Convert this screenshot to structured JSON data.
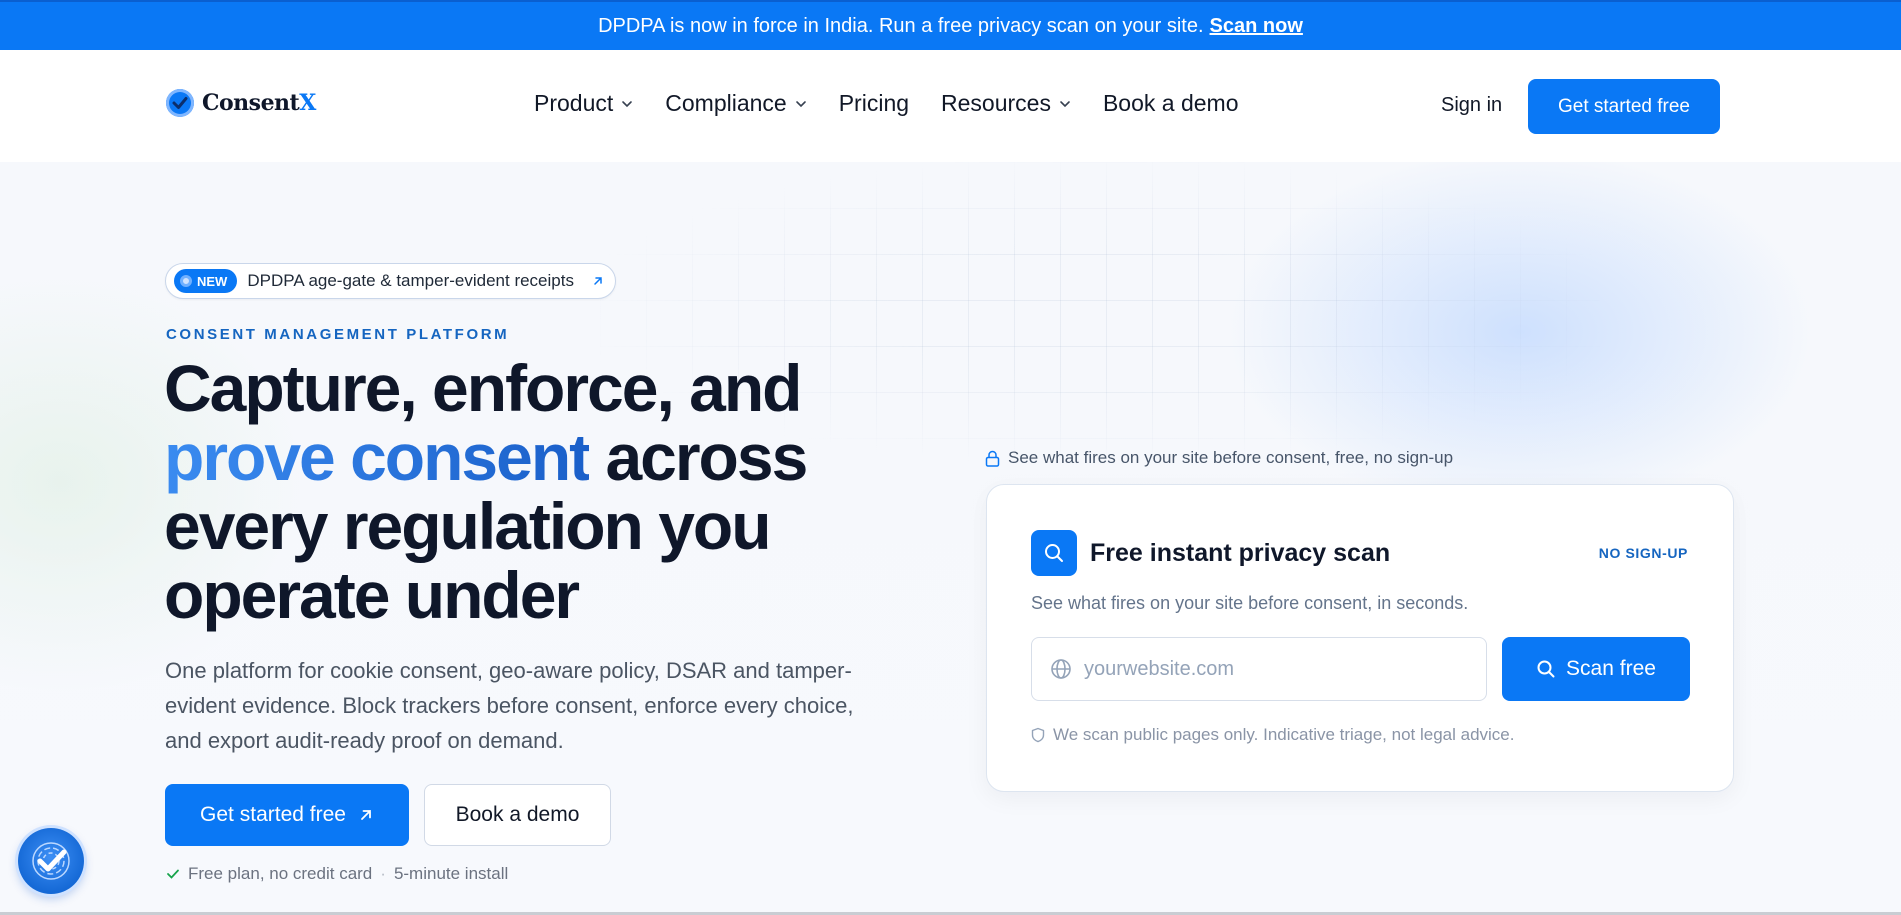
{
  "announcement": {
    "text": "DPDPA is now in force in India. Run a free privacy scan on your site.",
    "link": "Scan now"
  },
  "nav": {
    "logo": {
      "brand_main": "Consent",
      "brand_accent": "X"
    },
    "items": [
      {
        "label": "Product",
        "dropdown": true
      },
      {
        "label": "Compliance",
        "dropdown": true
      },
      {
        "label": "Pricing",
        "dropdown": false
      },
      {
        "label": "Resources",
        "dropdown": true
      },
      {
        "label": "Book a demo",
        "dropdown": false
      }
    ],
    "sign_in": "Sign in",
    "cta": "Get started free"
  },
  "hero": {
    "pill": {
      "badge": "NEW",
      "text": "DPDPA age-gate & tamper-evident receipts"
    },
    "eyebrow": "CONSENT MANAGEMENT PLATFORM",
    "headline": {
      "line1": "Capture, enforce, and",
      "highlight": "prove consent",
      "rest2": " across",
      "line3": "every regulation you",
      "line4": "operate under"
    },
    "subtext": "One platform for cookie consent, geo-aware policy, DSAR and tamper-evident evidence. Block trackers before consent, enforce every choice, and export audit-ready proof on demand.",
    "primary_button": "Get started free",
    "secondary_button": "Book a demo",
    "trust": {
      "item1": "Free plan, no credit card",
      "separator": "·",
      "item2": "5-minute install"
    }
  },
  "scan": {
    "note": "See what fires on your site before consent, free, no sign-up",
    "title": "Free instant privacy scan",
    "tag": "NO SIGN-UP",
    "description": "See what fires on your site before consent, in seconds.",
    "input_placeholder": "yourwebsite.com",
    "button": "Scan free",
    "footnote": "We scan public pages only. Indicative triage, not legal advice."
  },
  "colors": {
    "brand": "#0a78f5",
    "text": "#0f172a",
    "accent_text": "#1565c0"
  }
}
